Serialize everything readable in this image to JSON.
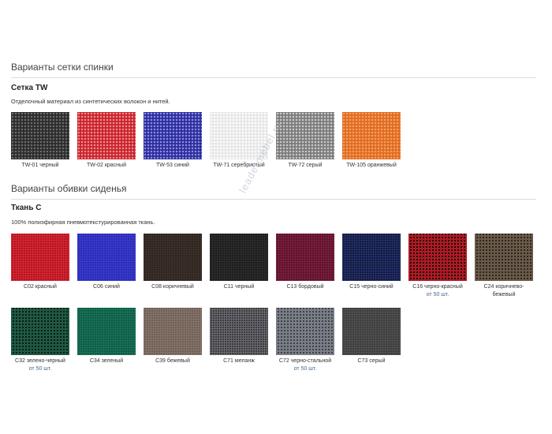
{
  "back": {
    "title": "Варианты сетки спинки",
    "subtitle": "Сетка TW",
    "description": "Отделочный материал из синтетических волокон и нитей.",
    "items": [
      {
        "label": "TW-01 черный",
        "bg": "#2a2a2a",
        "accent": "#6a6a6a"
      },
      {
        "label": "TW-02 красный",
        "bg": "#c8202a",
        "accent": "#f08a8a"
      },
      {
        "label": "TW-53 синий",
        "bg": "#2a2a9a",
        "accent": "#8a8ae0"
      },
      {
        "label": "TW-71 серебристый",
        "bg": "#e6e6e6",
        "accent": "#ffffff"
      },
      {
        "label": "TW-72 серый",
        "bg": "#7a7a7a",
        "accent": "#c8c8c8"
      },
      {
        "label": "TW-105 оранжевый",
        "bg": "#e06a20",
        "accent": "#f4a060"
      }
    ]
  },
  "seat": {
    "title": "Варианты обивки сиденья",
    "subtitle": "Ткань С",
    "description": "100% полиэфирная пневмотекстурированная ткань.",
    "row1": [
      {
        "label": "С02 красный",
        "note": "",
        "bg": "#b8101e",
        "accent": "#d02a36",
        "tex": "weave"
      },
      {
        "label": "С06 синий",
        "note": "",
        "bg": "#2a2ab0",
        "accent": "#3a3ad0",
        "tex": "weave"
      },
      {
        "label": "С08 коричневый",
        "note": "",
        "bg": "#2e2420",
        "accent": "#3c302a",
        "tex": "weave"
      },
      {
        "label": "С11 черный",
        "note": "",
        "bg": "#1c1c1c",
        "accent": "#2c2c2c",
        "tex": "weave"
      },
      {
        "label": "С13 бордовый",
        "note": "",
        "bg": "#5a1028",
        "accent": "#7a2040",
        "tex": "weave"
      },
      {
        "label": "С15 черно-синий",
        "note": "",
        "bg": "#101838",
        "accent": "#24306a",
        "tex": "weave"
      },
      {
        "label": "С16 черно-красный",
        "note": "от 50 шт.",
        "bg": "#1a0a0a",
        "accent": "#b01a24",
        "tex": "check"
      },
      {
        "label": "С24 коричнево-бежевый",
        "note": "",
        "bg": "#2a2420",
        "accent": "#6a5a48",
        "tex": "check"
      }
    ],
    "row2": [
      {
        "label": "С32 зелено-черный",
        "note": "от 50 шт.",
        "bg": "#0e1a16",
        "accent": "#1e5a44",
        "tex": "check"
      },
      {
        "label": "С34 зеленый",
        "note": "",
        "bg": "#0e5a44",
        "accent": "#1a7058",
        "tex": "weave"
      },
      {
        "label": "С39 бежевый",
        "note": "",
        "bg": "#6e5e54",
        "accent": "#84746a",
        "tex": "weave"
      },
      {
        "label": "С71 меланж",
        "note": "",
        "bg": "#3a3a3e",
        "accent": "#6a6a70",
        "tex": "weave"
      },
      {
        "label": "С72 черно-стальной",
        "note": "от 50 шт.",
        "bg": "#3e4046",
        "accent": "#7a7e86",
        "tex": "check"
      },
      {
        "label": "С73 серый",
        "note": "",
        "bg": "#3c3c3c",
        "accent": "#505050",
        "tex": "weave"
      }
    ]
  },
  "watermark": "leadermebel.ru"
}
